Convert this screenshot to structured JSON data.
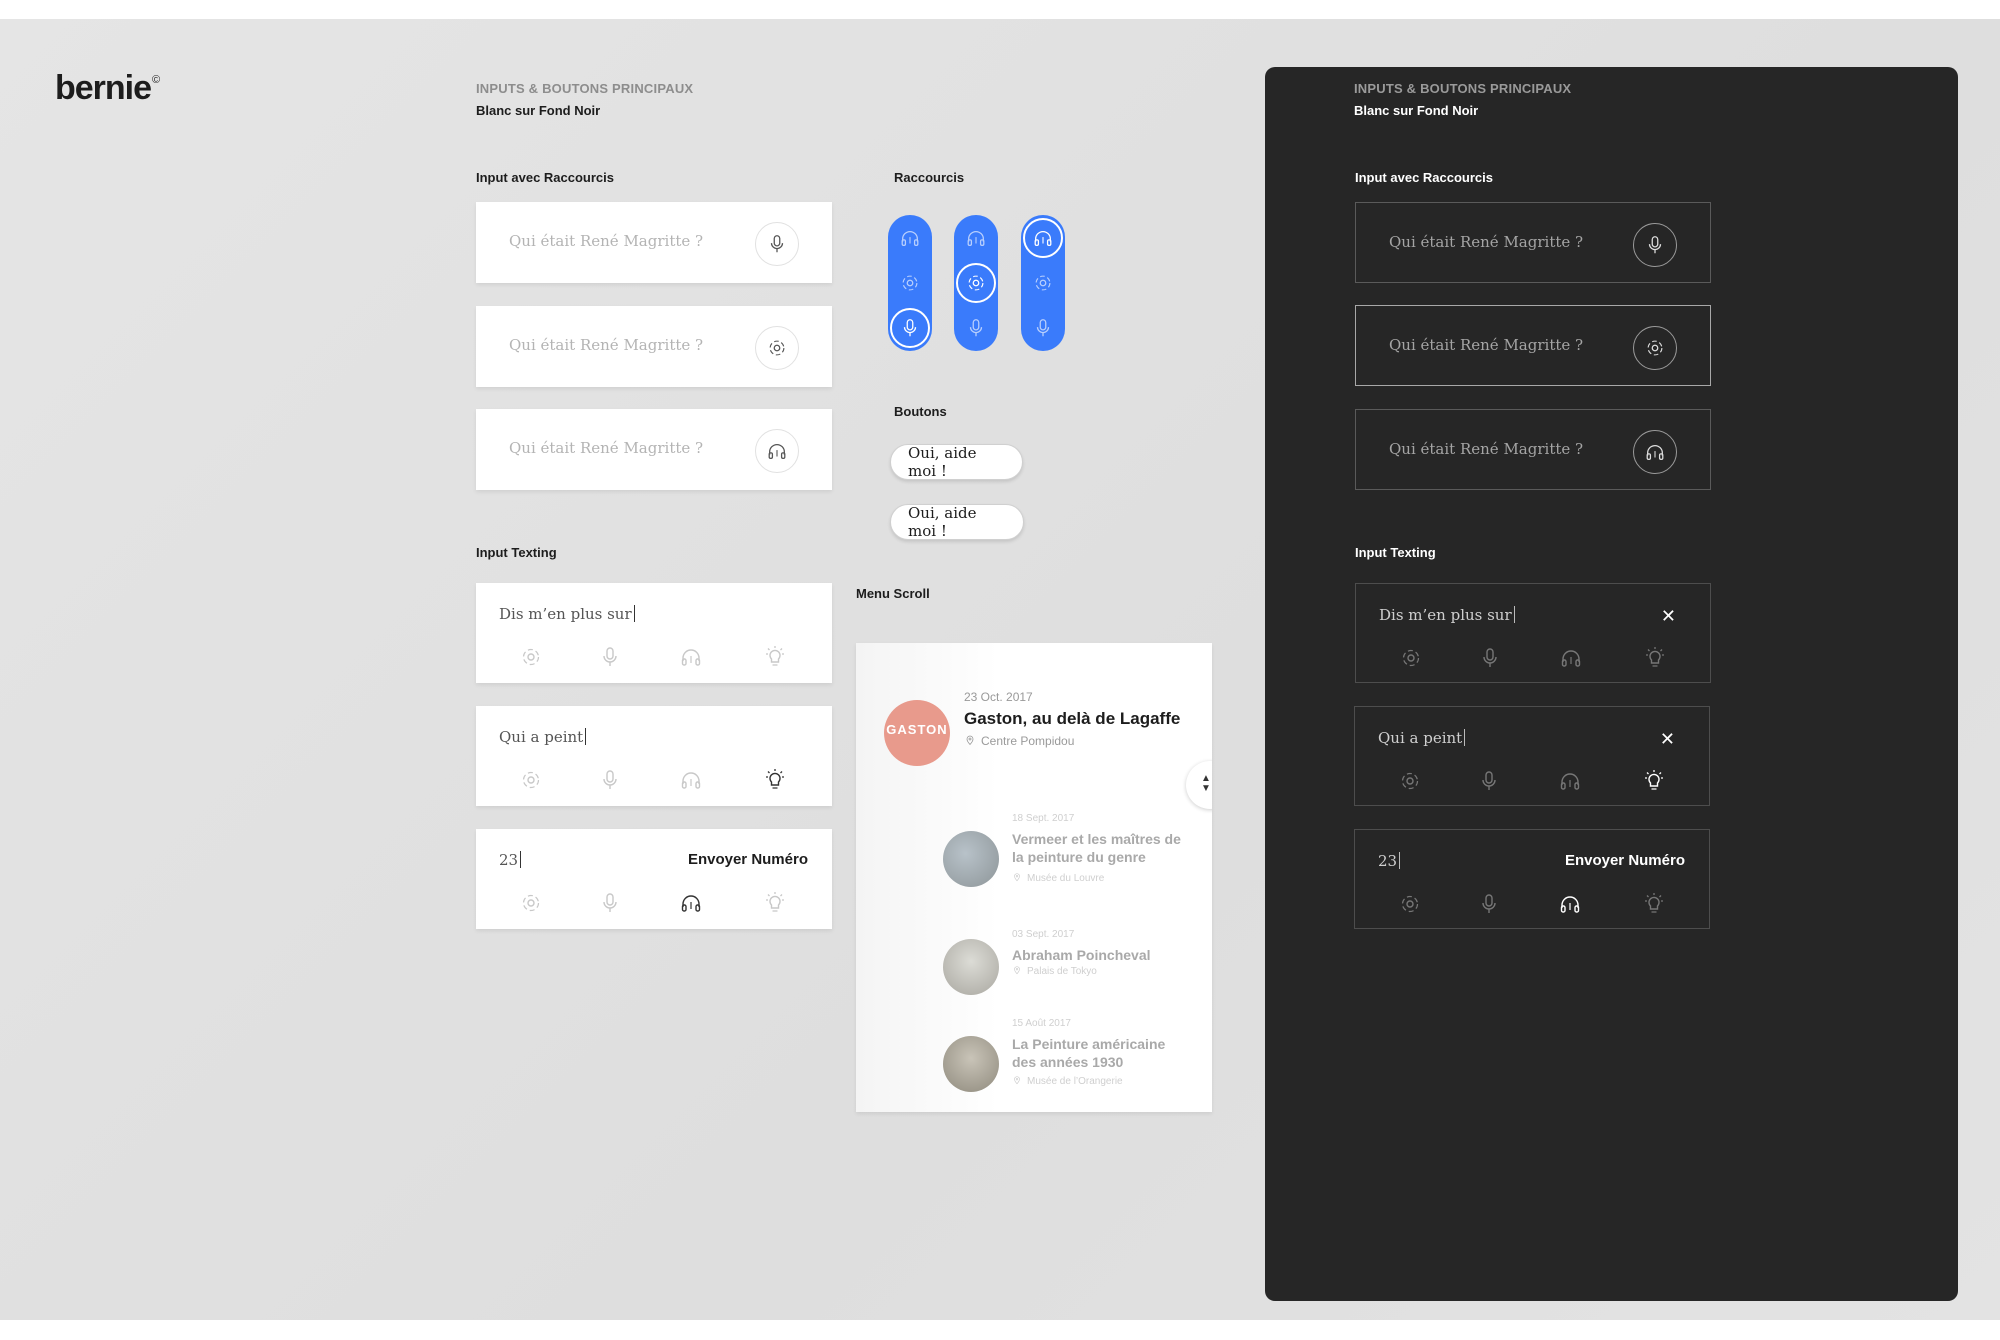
{
  "logo": {
    "text": "bernie",
    "mark": "©"
  },
  "light": {
    "header_caps": "INPUTS & BOUTONS PRINCIPAUX",
    "header_sub": "Blanc sur Fond Noir",
    "section_shortcut_inputs": "Input avec Raccourcis",
    "section_shortcuts": "Raccourcis",
    "section_buttons": "Boutons",
    "section_texting": "Input Texting",
    "section_menu": "Menu Scroll",
    "input_placeholder": "Qui était René Magritte ?",
    "shortcut_inputs": [
      {
        "icon": "microphone-icon"
      },
      {
        "icon": "camera-scan-icon"
      },
      {
        "icon": "headphones-icon"
      }
    ],
    "buttons": [
      "Oui, aide moi !",
      "Oui, aide moi !"
    ],
    "texting": [
      {
        "value": "Dis m’en plus sur",
        "active_icon": "none"
      },
      {
        "value": "Qui a peint",
        "active_icon": "lightbulb-icon"
      },
      {
        "value": "23",
        "action": "Envoyer Numéro",
        "active_icon": "headphones-icon"
      }
    ],
    "menu": {
      "featured": {
        "date": "23 Oct. 2017",
        "title": "Gaston, au delà de Lagaffe",
        "place": "Centre Pompidou",
        "thumb_text": "GASTON"
      },
      "items": [
        {
          "date": "18 Sept. 2017",
          "title": "Vermeer et les maîtres de la peinture du genre",
          "place": "Musée du Louvre"
        },
        {
          "date": "03 Sept. 2017",
          "title": "Abraham Poincheval",
          "place": "Palais de Tokyo"
        },
        {
          "date": "15 Août 2017",
          "title": "La Peinture américaine des années 1930",
          "place": "Musée de l’Orangerie"
        }
      ]
    }
  },
  "dark": {
    "header_caps": "INPUTS & BOUTONS PRINCIPAUX",
    "header_sub": "Blanc sur Fond Noir",
    "section_shortcut_inputs": "Input avec Raccourcis",
    "section_texting": "Input Texting",
    "input_placeholder": "Qui était René Magritte ?",
    "texting": [
      {
        "value": "Dis m’en plus sur",
        "close": "✕"
      },
      {
        "value": "Qui a peint",
        "close": "✕"
      },
      {
        "value": "23",
        "action": "Envoyer Numéro"
      }
    ]
  },
  "colors": {
    "accent_blue": "#3a7bfb",
    "dark_panel": "#262626",
    "background": "#e2e2e2"
  }
}
